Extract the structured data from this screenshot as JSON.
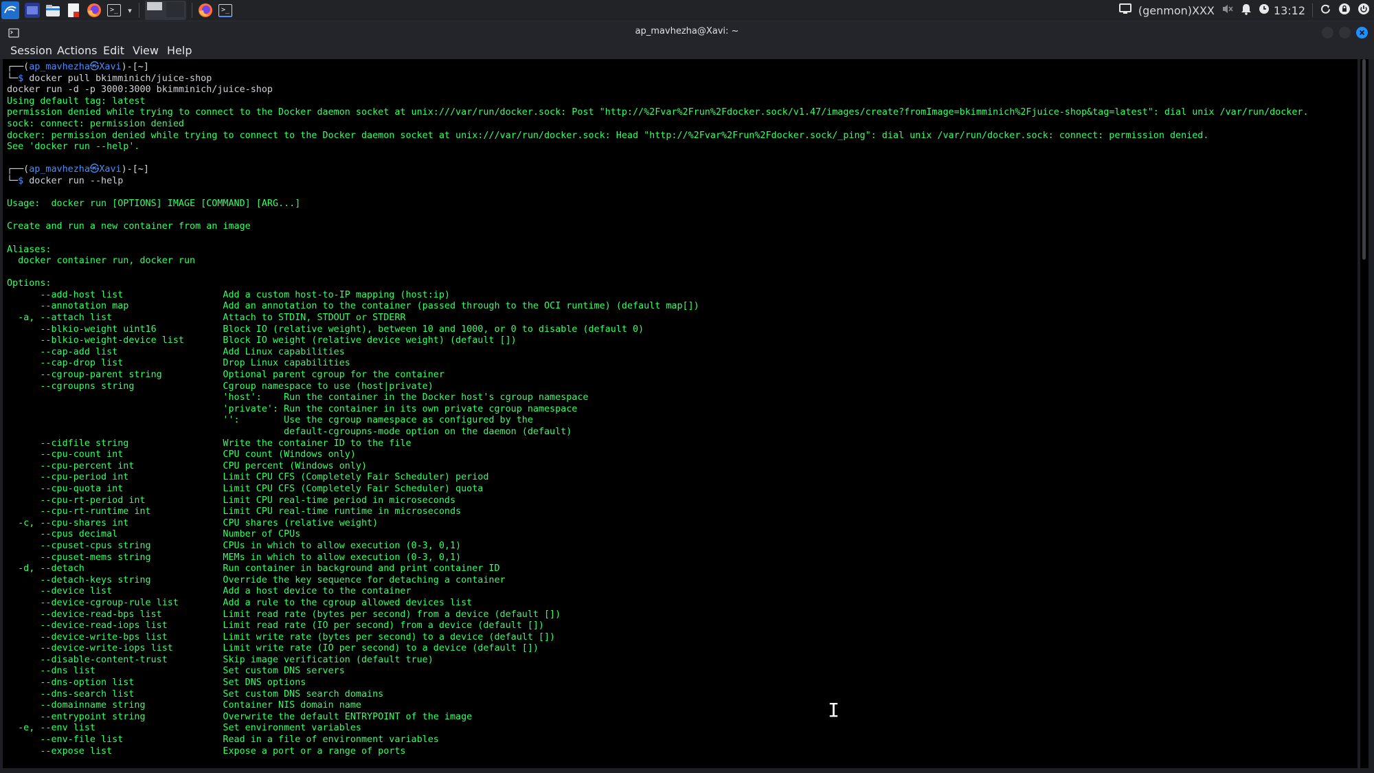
{
  "taskbar": {
    "network_label": "(genmon)XXX",
    "clock": "13:12",
    "apps": [
      {
        "icon": "kali-menu-icon"
      },
      {
        "icon": "show-desktop-icon"
      },
      {
        "icon": "file-manager-icon"
      },
      {
        "icon": "text-editor-icon"
      },
      {
        "icon": "firefox-icon"
      },
      {
        "icon": "terminal-icon"
      },
      {
        "icon": "chevron-down-icon"
      },
      {
        "icon": "workspace-switcher-icon"
      },
      {
        "icon": "firefox-window-icon"
      },
      {
        "icon": "terminal-window-icon"
      }
    ],
    "tray": [
      "monitor-icon",
      "mute-icon",
      "bell-icon",
      "clock-icon",
      "refresh-icon",
      "lock-icon",
      "power-icon"
    ]
  },
  "window": {
    "title": "ap_mavhezha@Xavi: ~",
    "menu": [
      "Session",
      "Actions",
      "Edit",
      "View",
      "Help"
    ]
  },
  "terminal": {
    "lines": [
      {
        "segs": [
          {
            "t": "┌──(",
            "c": "gray"
          },
          {
            "t": "ap_mavhezha㉿Xavi",
            "c": "blue"
          },
          {
            "t": ")-[",
            "c": "gray"
          },
          {
            "t": "~",
            "c": "white"
          },
          {
            "t": "]",
            "c": "gray"
          }
        ]
      },
      {
        "segs": [
          {
            "t": "└─",
            "c": "gray"
          },
          {
            "t": "$ ",
            "c": "blue"
          },
          {
            "t": "docker pull bkimminich/juice-shop",
            "c": "gray"
          }
        ]
      },
      {
        "segs": [
          {
            "t": "docker run -d -p 3000:3000 bkimminich/juice-shop",
            "c": "gray"
          }
        ]
      },
      {
        "segs": [
          {
            "t": "Using default tag: latest",
            "c": "green"
          }
        ]
      },
      {
        "segs": [
          {
            "t": "permission denied while trying to connect to the Docker daemon socket at unix:///var/run/docker.sock: Post \"http://%2Fvar%2Frun%2Fdocker.sock/v1.47/images/create?fromImage=bkimminich%2Fjuice-shop&tag=latest\": dial unix /var/run/docker.",
            "c": "green"
          }
        ]
      },
      {
        "segs": [
          {
            "t": "sock: connect: permission denied",
            "c": "green"
          }
        ]
      },
      {
        "segs": [
          {
            "t": "docker: permission denied while trying to connect to the Docker daemon socket at unix:///var/run/docker.sock: Head \"http://%2Fvar%2Frun%2Fdocker.sock/_ping\": dial unix /var/run/docker.sock: connect: permission denied.",
            "c": "green"
          }
        ]
      },
      {
        "segs": [
          {
            "t": "See 'docker run --help'.",
            "c": "green"
          }
        ]
      },
      {
        "segs": [
          {
            "t": "",
            "c": "green"
          }
        ]
      },
      {
        "segs": [
          {
            "t": "┌──(",
            "c": "gray"
          },
          {
            "t": "ap_mavhezha㉿Xavi",
            "c": "blue"
          },
          {
            "t": ")-[",
            "c": "gray"
          },
          {
            "t": "~",
            "c": "white"
          },
          {
            "t": "]",
            "c": "gray"
          }
        ]
      },
      {
        "segs": [
          {
            "t": "└─",
            "c": "gray"
          },
          {
            "t": "$ ",
            "c": "blue"
          },
          {
            "t": "docker run --help",
            "c": "gray"
          }
        ]
      },
      {
        "segs": [
          {
            "t": "",
            "c": "green"
          }
        ]
      },
      {
        "segs": [
          {
            "t": "Usage:  docker run [OPTIONS] IMAGE [COMMAND] [ARG...]",
            "c": "green"
          }
        ]
      },
      {
        "segs": [
          {
            "t": "",
            "c": "green"
          }
        ]
      },
      {
        "segs": [
          {
            "t": "Create and run a new container from an image",
            "c": "green"
          }
        ]
      },
      {
        "segs": [
          {
            "t": "",
            "c": "green"
          }
        ]
      },
      {
        "segs": [
          {
            "t": "Aliases:",
            "c": "green"
          }
        ]
      },
      {
        "segs": [
          {
            "t": "  docker container run, docker run",
            "c": "green"
          }
        ]
      },
      {
        "segs": [
          {
            "t": "",
            "c": "green"
          }
        ]
      },
      {
        "segs": [
          {
            "t": "Options:",
            "c": "green"
          }
        ]
      },
      {
        "segs": [
          {
            "t": "      --add-host list                  Add a custom host-to-IP mapping (host:ip)",
            "c": "green"
          }
        ]
      },
      {
        "segs": [
          {
            "t": "      --annotation map                 Add an annotation to the container (passed through to the OCI runtime) (default map[])",
            "c": "green"
          }
        ]
      },
      {
        "segs": [
          {
            "t": "  -a, --attach list                    Attach to STDIN, STDOUT or STDERR",
            "c": "green"
          }
        ]
      },
      {
        "segs": [
          {
            "t": "      --blkio-weight uint16            Block IO (relative weight), between 10 and 1000, or 0 to disable (default 0)",
            "c": "green"
          }
        ]
      },
      {
        "segs": [
          {
            "t": "      --blkio-weight-device list       Block IO weight (relative device weight) (default [])",
            "c": "green"
          }
        ]
      },
      {
        "segs": [
          {
            "t": "      --cap-add list                   Add Linux capabilities",
            "c": "green"
          }
        ]
      },
      {
        "segs": [
          {
            "t": "      --cap-drop list                  Drop Linux capabilities",
            "c": "green"
          }
        ]
      },
      {
        "segs": [
          {
            "t": "      --cgroup-parent string           Optional parent cgroup for the container",
            "c": "green"
          }
        ]
      },
      {
        "segs": [
          {
            "t": "      --cgroupns string                Cgroup namespace to use (host|private)",
            "c": "green"
          }
        ]
      },
      {
        "segs": [
          {
            "t": "                                       'host':    Run the container in the Docker host's cgroup namespace",
            "c": "green"
          }
        ]
      },
      {
        "segs": [
          {
            "t": "                                       'private': Run the container in its own private cgroup namespace",
            "c": "green"
          }
        ]
      },
      {
        "segs": [
          {
            "t": "                                       '':        Use the cgroup namespace as configured by the",
            "c": "green"
          }
        ]
      },
      {
        "segs": [
          {
            "t": "                                                  default-cgroupns-mode option on the daemon (default)",
            "c": "green"
          }
        ]
      },
      {
        "segs": [
          {
            "t": "      --cidfile string                 Write the container ID to the file",
            "c": "green"
          }
        ]
      },
      {
        "segs": [
          {
            "t": "      --cpu-count int                  CPU count (Windows only)",
            "c": "green"
          }
        ]
      },
      {
        "segs": [
          {
            "t": "      --cpu-percent int                CPU percent (Windows only)",
            "c": "green"
          }
        ]
      },
      {
        "segs": [
          {
            "t": "      --cpu-period int                 Limit CPU CFS (Completely Fair Scheduler) period",
            "c": "green"
          }
        ]
      },
      {
        "segs": [
          {
            "t": "      --cpu-quota int                  Limit CPU CFS (Completely Fair Scheduler) quota",
            "c": "green"
          }
        ]
      },
      {
        "segs": [
          {
            "t": "      --cpu-rt-period int              Limit CPU real-time period in microseconds",
            "c": "green"
          }
        ]
      },
      {
        "segs": [
          {
            "t": "      --cpu-rt-runtime int             Limit CPU real-time runtime in microseconds",
            "c": "green"
          }
        ]
      },
      {
        "segs": [
          {
            "t": "  -c, --cpu-shares int                 CPU shares (relative weight)",
            "c": "green"
          }
        ]
      },
      {
        "segs": [
          {
            "t": "      --cpus decimal                   Number of CPUs",
            "c": "green"
          }
        ]
      },
      {
        "segs": [
          {
            "t": "      --cpuset-cpus string             CPUs in which to allow execution (0-3, 0,1)",
            "c": "green"
          }
        ]
      },
      {
        "segs": [
          {
            "t": "      --cpuset-mems string             MEMs in which to allow execution (0-3, 0,1)",
            "c": "green"
          }
        ]
      },
      {
        "segs": [
          {
            "t": "  -d, --detach                         Run container in background and print container ID",
            "c": "green"
          }
        ]
      },
      {
        "segs": [
          {
            "t": "      --detach-keys string             Override the key sequence for detaching a container",
            "c": "green"
          }
        ]
      },
      {
        "segs": [
          {
            "t": "      --device list                    Add a host device to the container",
            "c": "green"
          }
        ]
      },
      {
        "segs": [
          {
            "t": "      --device-cgroup-rule list        Add a rule to the cgroup allowed devices list",
            "c": "green"
          }
        ]
      },
      {
        "segs": [
          {
            "t": "      --device-read-bps list           Limit read rate (bytes per second) from a device (default [])",
            "c": "green"
          }
        ]
      },
      {
        "segs": [
          {
            "t": "      --device-read-iops list          Limit read rate (IO per second) from a device (default [])",
            "c": "green"
          }
        ]
      },
      {
        "segs": [
          {
            "t": "      --device-write-bps list          Limit write rate (bytes per second) to a device (default [])",
            "c": "green"
          }
        ]
      },
      {
        "segs": [
          {
            "t": "      --device-write-iops list         Limit write rate (IO per second) to a device (default [])",
            "c": "green"
          }
        ]
      },
      {
        "segs": [
          {
            "t": "      --disable-content-trust          Skip image verification (default true)",
            "c": "green"
          }
        ]
      },
      {
        "segs": [
          {
            "t": "      --dns list                       Set custom DNS servers",
            "c": "green"
          }
        ]
      },
      {
        "segs": [
          {
            "t": "      --dns-option list                Set DNS options",
            "c": "green"
          }
        ]
      },
      {
        "segs": [
          {
            "t": "      --dns-search list                Set custom DNS search domains",
            "c": "green"
          }
        ]
      },
      {
        "segs": [
          {
            "t": "      --domainname string              Container NIS domain name",
            "c": "green"
          }
        ]
      },
      {
        "segs": [
          {
            "t": "      --entrypoint string              Overwrite the default ENTRYPOINT of the image",
            "c": "green"
          }
        ]
      },
      {
        "segs": [
          {
            "t": "  -e, --env list                       Set environment variables",
            "c": "green"
          }
        ]
      },
      {
        "segs": [
          {
            "t": "      --env-file list                  Read in a file of environment variables",
            "c": "green"
          }
        ]
      },
      {
        "segs": [
          {
            "t": "      --expose list                    Expose a port or a range of ports",
            "c": "green"
          }
        ]
      }
    ]
  },
  "colors": {
    "green": "#33ff66",
    "blue": "#4e8ef7",
    "gray": "#cfd3d7",
    "white": "#e8eaed",
    "close_button": "#1e90ff"
  }
}
